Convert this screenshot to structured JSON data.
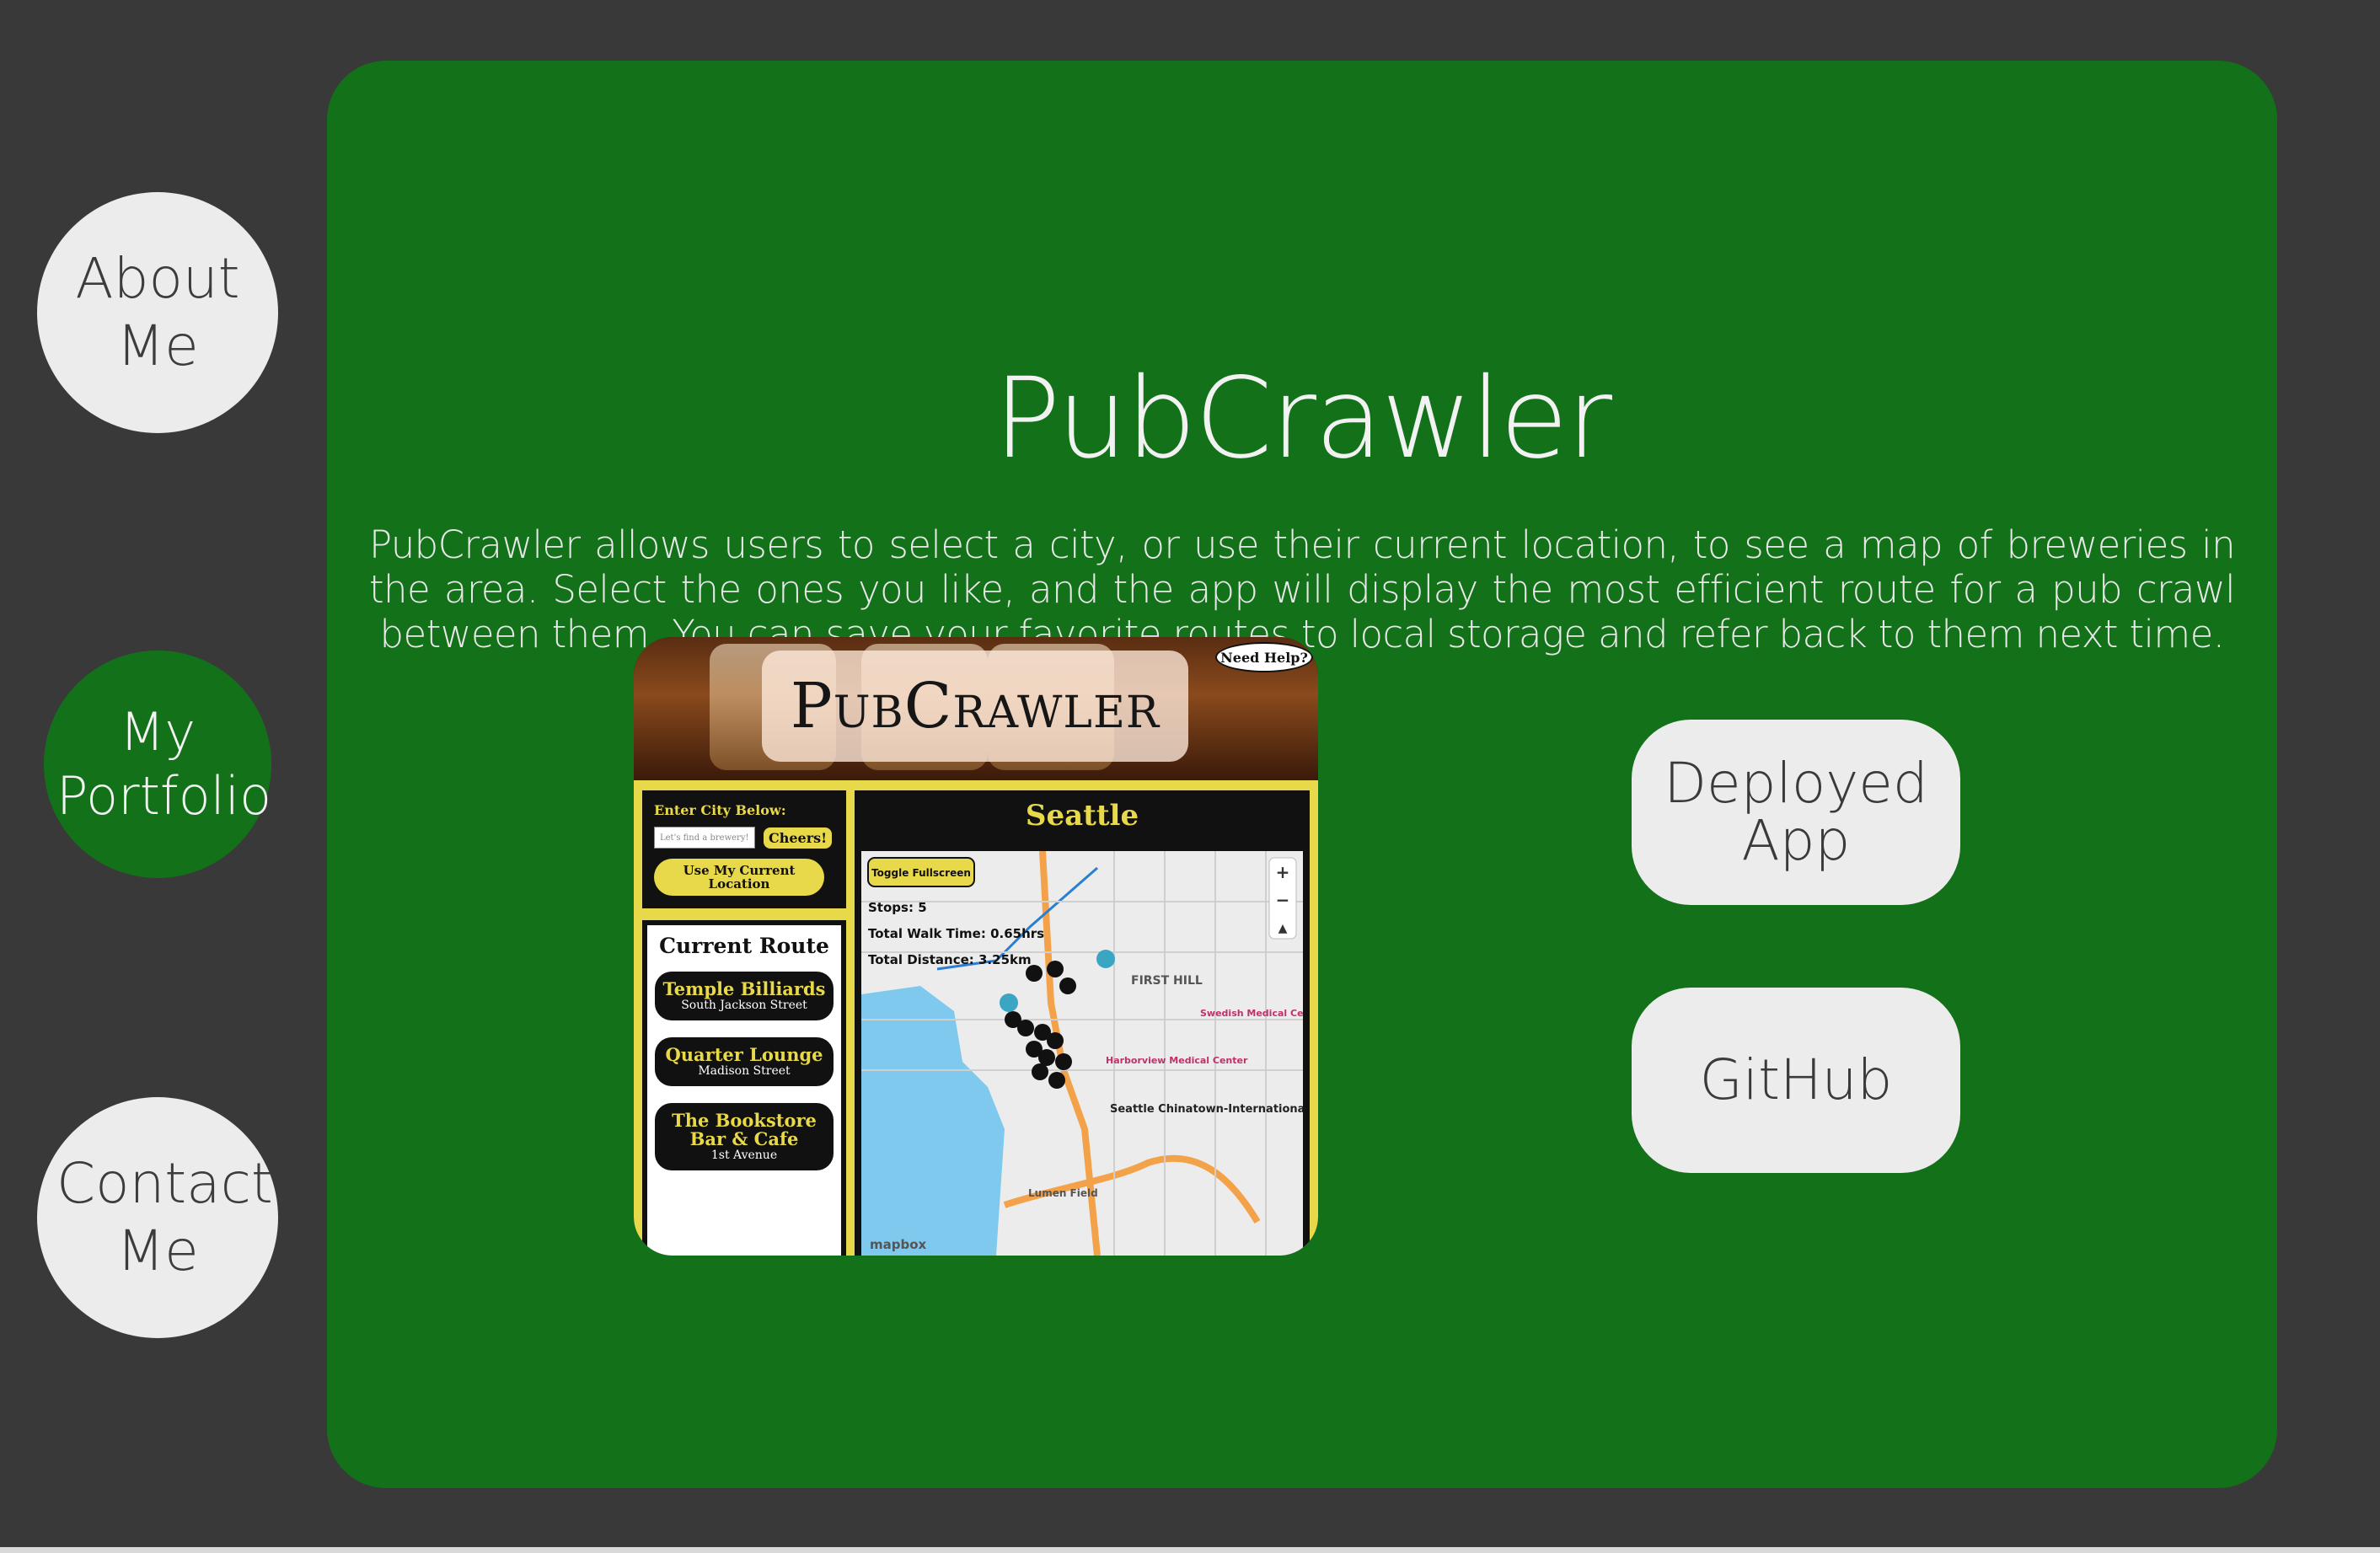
{
  "nav": {
    "about": [
      "About",
      "Me"
    ],
    "portfolio": [
      "My",
      "Portfolio"
    ],
    "contact": [
      "Contact",
      "Me"
    ]
  },
  "project": {
    "title": "PubCrawler",
    "description": "PubCrawler allows users to select a city, or use their current location, to see a map of breweries in the area. Select the ones you like, and the app will display the most efficient route for a pub crawl between them. You can save your favorite routes to local storage and refer back to them next time."
  },
  "buttons": {
    "deployed": [
      "Deployed",
      "App"
    ],
    "github": "GitHub"
  },
  "screenshot": {
    "logo": "PubCrawler",
    "help": "Need Help?",
    "city_label": "Enter City Below:",
    "city_placeholder": "Let's find a brewery!",
    "cheers": "Cheers!",
    "location_btn": "Use My Current Location",
    "route_title": "Current Route",
    "route_items": [
      {
        "name": "Temple Billiards",
        "addr": "South Jackson Street"
      },
      {
        "name": "Quarter Lounge",
        "addr": "Madison Street"
      },
      {
        "name": "The Bookstore Bar & Cafe",
        "addr": "1st Avenue"
      }
    ],
    "city": "Seattle",
    "map": {
      "toggle": "Toggle Fullscreen",
      "stops_label": "Stops:",
      "stops": "5",
      "walk_label": "Total Walk Time:",
      "walk": "0.65hrs",
      "dist_label": "Total Distance:",
      "dist": "3.25km",
      "labels": [
        "FIRST HILL",
        "Swedish Medical Center",
        "Harborview Medical Center",
        "Seattle Chinatown-International District",
        "Lumen Field",
        "mapbox"
      ]
    }
  },
  "colors": {
    "background": "#393939",
    "card": "#137219",
    "button": "#ececec",
    "accent_yellow": "#e8d94a"
  }
}
